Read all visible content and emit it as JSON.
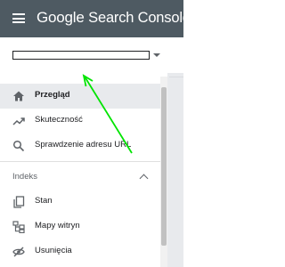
{
  "header": {
    "brand_google": "Google",
    "brand_product": "Search Console"
  },
  "property_selector": {
    "value": ""
  },
  "nav": {
    "items": [
      {
        "label": "Przegląd",
        "icon": "home-icon",
        "active": true
      },
      {
        "label": "Skuteczność",
        "icon": "trending-up-icon",
        "active": false
      },
      {
        "label": "Sprawdzenie adresu URL",
        "icon": "search-icon",
        "active": false
      }
    ],
    "section": {
      "label": "Indeks"
    },
    "index_items": [
      {
        "label": "Stan",
        "icon": "pages-icon"
      },
      {
        "label": "Mapy witryn",
        "icon": "sitemap-icon"
      },
      {
        "label": "Usunięcia",
        "icon": "eye-off-icon"
      }
    ]
  },
  "colors": {
    "header_bg": "#4e5a62",
    "active_bg": "#e8eaed",
    "arrow": "#00e400"
  }
}
